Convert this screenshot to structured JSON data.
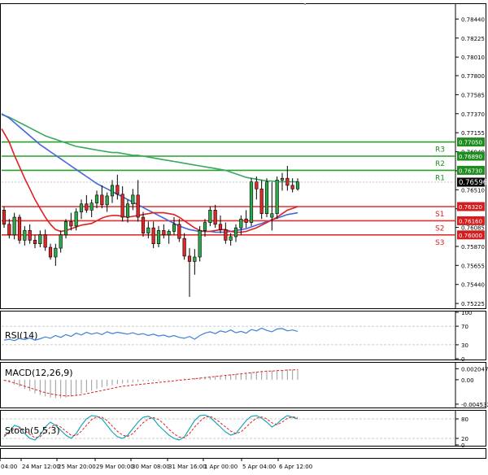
{
  "chart_data": {
    "type": "candlestick",
    "main": {
      "y_ticks": [
        "0.78440",
        "0.78225",
        "0.78010",
        "0.77800",
        "0.77585",
        "0.77370",
        "0.77155",
        "0.76940",
        "0.76725",
        "0.76510",
        "0.76295",
        "0.76085",
        "0.75870",
        "0.75655",
        "0.75440",
        "0.75225"
      ],
      "ylim": [
        0.7518,
        0.786
      ],
      "x_ticks": [
        "04:00",
        "24 Mar 12:00",
        "25 Mar 20:00",
        "29 Mar 00:00",
        "30 Mar 08:00",
        "31 Mar 16:00",
        "1 Apr 00:00",
        "5 Apr 04:00",
        "6 Apr 12:00"
      ],
      "levels": [
        {
          "name": "R3",
          "value": 0.7705,
          "label": "0.77050",
          "color": "#1e8c1e",
          "line": "#2aa02a"
        },
        {
          "name": "R2",
          "value": 0.7689,
          "label": "0.76890",
          "color": "#1e8c1e",
          "line": "#2aa02a"
        },
        {
          "name": "R1",
          "value": 0.7673,
          "label": "0.76730",
          "color": "#1e8c1e",
          "line": "#2aa02a"
        },
        {
          "name": "S1",
          "value": 0.7632,
          "label": "0.76320",
          "color": "#d21e1e",
          "line": "#e03030"
        },
        {
          "name": "S2",
          "value": 0.7616,
          "label": "0.76160",
          "color": "#d21e1e",
          "line": "#e03030"
        },
        {
          "name": "S3",
          "value": 0.76,
          "label": "0.76000",
          "color": "#d21e1e",
          "line": "#e03030"
        }
      ],
      "current_price": "0.76596",
      "current_price_value": 0.76596,
      "candles": [
        [
          0.7628,
          0.7632,
          0.7608,
          0.7612
        ],
        [
          0.7612,
          0.7618,
          0.7596,
          0.76
        ],
        [
          0.76,
          0.7625,
          0.7595,
          0.762
        ],
        [
          0.762,
          0.7623,
          0.759,
          0.7594
        ],
        [
          0.7594,
          0.761,
          0.7588,
          0.7605
        ],
        [
          0.7605,
          0.7612,
          0.759,
          0.7594
        ],
        [
          0.7594,
          0.76,
          0.7585,
          0.759
        ],
        [
          0.759,
          0.7605,
          0.7586,
          0.76
        ],
        [
          0.76,
          0.7606,
          0.7582,
          0.7586
        ],
        [
          0.7586,
          0.759,
          0.7572,
          0.7575
        ],
        [
          0.7575,
          0.759,
          0.7565,
          0.7585
        ],
        [
          0.7585,
          0.7605,
          0.758,
          0.76
        ],
        [
          0.76,
          0.7618,
          0.7596,
          0.7615
        ],
        [
          0.7615,
          0.7625,
          0.7605,
          0.761
        ],
        [
          0.761,
          0.763,
          0.7605,
          0.7626
        ],
        [
          0.7626,
          0.764,
          0.7618,
          0.7635
        ],
        [
          0.7635,
          0.7645,
          0.7625,
          0.7628
        ],
        [
          0.7628,
          0.764,
          0.762,
          0.7636
        ],
        [
          0.7636,
          0.765,
          0.763,
          0.7645
        ],
        [
          0.7645,
          0.7656,
          0.763,
          0.7634
        ],
        [
          0.7634,
          0.7648,
          0.7626,
          0.7644
        ],
        [
          0.7644,
          0.7662,
          0.7636,
          0.7656
        ],
        [
          0.7656,
          0.7668,
          0.764,
          0.7646
        ],
        [
          0.7646,
          0.7655,
          0.7615,
          0.762
        ],
        [
          0.762,
          0.764,
          0.7614,
          0.7635
        ],
        [
          0.7635,
          0.7652,
          0.7628,
          0.7645
        ],
        [
          0.7645,
          0.7662,
          0.7615,
          0.762
        ],
        [
          0.762,
          0.7626,
          0.7598,
          0.7602
        ],
        [
          0.7602,
          0.7615,
          0.7596,
          0.7608
        ],
        [
          0.7608,
          0.7615,
          0.7585,
          0.759
        ],
        [
          0.759,
          0.761,
          0.7586,
          0.7605
        ],
        [
          0.7605,
          0.7612,
          0.7596,
          0.76
        ],
        [
          0.76,
          0.7606,
          0.759,
          0.7604
        ],
        [
          0.7604,
          0.762,
          0.76,
          0.7612
        ],
        [
          0.7612,
          0.7618,
          0.7592,
          0.7596
        ],
        [
          0.7596,
          0.7602,
          0.7572,
          0.7576
        ],
        [
          0.7576,
          0.7585,
          0.753,
          0.757
        ],
        [
          0.757,
          0.7584,
          0.7555,
          0.7575
        ],
        [
          0.7575,
          0.761,
          0.757,
          0.7605
        ],
        [
          0.7605,
          0.7618,
          0.7598,
          0.7614
        ],
        [
          0.7614,
          0.7632,
          0.761,
          0.7628
        ],
        [
          0.7628,
          0.7634,
          0.7608,
          0.7612
        ],
        [
          0.7612,
          0.7622,
          0.7602,
          0.7606
        ],
        [
          0.7606,
          0.7614,
          0.759,
          0.7594
        ],
        [
          0.7594,
          0.7602,
          0.7588,
          0.7598
        ],
        [
          0.7598,
          0.7612,
          0.7592,
          0.7608
        ],
        [
          0.7608,
          0.7622,
          0.76,
          0.7618
        ],
        [
          0.7618,
          0.7628,
          0.7608,
          0.7614
        ],
        [
          0.7614,
          0.7664,
          0.761,
          0.766
        ],
        [
          0.766,
          0.7666,
          0.764,
          0.7652
        ],
        [
          0.7652,
          0.7662,
          0.7618,
          0.7624
        ],
        [
          0.7624,
          0.7664,
          0.762,
          0.766
        ],
        [
          0.762,
          0.766,
          0.7605,
          0.7624
        ],
        [
          0.7624,
          0.7666,
          0.7618,
          0.7662
        ],
        [
          0.7662,
          0.767,
          0.765,
          0.7664
        ],
        [
          0.7664,
          0.7678,
          0.765,
          0.7656
        ],
        [
          0.7656,
          0.7664,
          0.7648,
          0.7652
        ],
        [
          0.7652,
          0.7664,
          0.765,
          0.766
        ]
      ],
      "ma_green": [
        0.7736,
        0.7733,
        0.773,
        0.7727,
        0.7724,
        0.7721,
        0.7718,
        0.7715,
        0.7712,
        0.771,
        0.7708,
        0.7706,
        0.7704,
        0.7702,
        0.77,
        0.7699,
        0.7698,
        0.7697,
        0.7696,
        0.7695,
        0.7694,
        0.7693,
        0.7693,
        0.7692,
        0.7691,
        0.769,
        0.769,
        0.7689,
        0.7688,
        0.7687,
        0.7686,
        0.7685,
        0.7684,
        0.7683,
        0.7682,
        0.7681,
        0.768,
        0.7679,
        0.7678,
        0.7677,
        0.7676,
        0.7675,
        0.7674,
        0.7673,
        0.7671,
        0.7669,
        0.7667,
        0.7665,
        0.7664,
        0.7663,
        0.7662,
        0.7661,
        0.7661,
        0.766,
        0.766,
        0.766,
        0.766,
        0.766
      ],
      "ma_blue": [
        0.7737,
        0.7732,
        0.7727,
        0.7722,
        0.7717,
        0.7712,
        0.7707,
        0.7702,
        0.7698,
        0.7694,
        0.769,
        0.7686,
        0.7682,
        0.7678,
        0.7674,
        0.767,
        0.7666,
        0.7662,
        0.7658,
        0.7655,
        0.7652,
        0.7649,
        0.7646,
        0.7643,
        0.764,
        0.7637,
        0.7634,
        0.7631,
        0.7628,
        0.7625,
        0.7622,
        0.7619,
        0.7616,
        0.7613,
        0.761,
        0.7608,
        0.7606,
        0.7605,
        0.7604,
        0.7604,
        0.7604,
        0.7603,
        0.7603,
        0.7603,
        0.7604,
        0.7605,
        0.7606,
        0.7607,
        0.7609,
        0.7611,
        0.7613,
        0.7615,
        0.7617,
        0.7619,
        0.7621,
        0.7623,
        0.7624,
        0.7625
      ],
      "ma_red": [
        0.772,
        0.7705,
        0.769,
        0.7677,
        0.7664,
        0.7652,
        0.764,
        0.763,
        0.762,
        0.7612,
        0.7606,
        0.7604,
        0.7605,
        0.7607,
        0.7609,
        0.7611,
        0.7612,
        0.7613,
        0.7616,
        0.7619,
        0.7621,
        0.7622,
        0.7622,
        0.7621,
        0.762,
        0.7621,
        0.7622,
        0.7623,
        0.7624,
        0.7625,
        0.7625,
        0.7625,
        0.7624,
        0.7623,
        0.762,
        0.7616,
        0.7612,
        0.7608,
        0.7605,
        0.7604,
        0.7604,
        0.7605,
        0.7606,
        0.7606,
        0.7604,
        0.7603,
        0.7603,
        0.7604,
        0.7606,
        0.7608,
        0.7611,
        0.7614,
        0.7617,
        0.762,
        0.7624,
        0.7628,
        0.763,
        0.7632
      ]
    },
    "rsi": {
      "label": "RSI(14)",
      "ticks": [
        "100",
        "70",
        "30",
        "0"
      ],
      "values": [
        40,
        42,
        39,
        44,
        41,
        45,
        40,
        43,
        47,
        44,
        50,
        46,
        52,
        48,
        55,
        51,
        57,
        53,
        56,
        52,
        58,
        54,
        57,
        55,
        53,
        56,
        52,
        54,
        50,
        53,
        49,
        51,
        47,
        50,
        46,
        44,
        48,
        42,
        50,
        55,
        58,
        54,
        60,
        57,
        62,
        56,
        59,
        55,
        63,
        60,
        66,
        61,
        58,
        64,
        65,
        60,
        62,
        59
      ]
    },
    "macd": {
      "label": "MACD(12,26,9)",
      "ticks": [
        "0.002047",
        "0.00",
        "-0.004532"
      ],
      "histogram": [
        -0.0002,
        -0.0005,
        -0.0009,
        -0.0013,
        -0.0017,
        -0.0021,
        -0.0025,
        -0.0028,
        -0.0031,
        -0.0033,
        -0.0034,
        -0.0034,
        -0.0033,
        -0.0031,
        -0.0029,
        -0.0026,
        -0.0023,
        -0.002,
        -0.0017,
        -0.0014,
        -0.0012,
        -0.001,
        -0.0008,
        -0.0007,
        -0.0006,
        -0.0005,
        -0.0004,
        -0.0003,
        -0.0003,
        -0.0002,
        -0.0002,
        -0.0001,
        -0.0001,
        0.0,
        0.0001,
        0.0002,
        0.0002,
        0.0003,
        0.0004,
        0.0005,
        0.0006,
        0.0007,
        0.0008,
        0.0009,
        0.001,
        0.0011,
        0.0012,
        0.0013,
        0.0014,
        0.0015,
        0.0016,
        0.0017,
        0.0017,
        0.0018,
        0.0018,
        0.0019,
        0.0019,
        0.0019
      ],
      "signal": [
        -0.0001,
        -0.0003,
        -0.0006,
        -0.0009,
        -0.0012,
        -0.0015,
        -0.0018,
        -0.0021,
        -0.0024,
        -0.0026,
        -0.0028,
        -0.0029,
        -0.003,
        -0.003,
        -0.0029,
        -0.0028,
        -0.0026,
        -0.0024,
        -0.0022,
        -0.002,
        -0.0018,
        -0.0016,
        -0.0014,
        -0.0012,
        -0.0011,
        -0.001,
        -0.0009,
        -0.0008,
        -0.0007,
        -0.0006,
        -0.0005,
        -0.0004,
        -0.0003,
        -0.0002,
        -0.0001,
        0.0,
        0.0001,
        0.0002,
        0.0003,
        0.0004,
        0.0005,
        0.0006,
        0.0007,
        0.0008,
        0.0009,
        0.001,
        0.0011,
        0.0012,
        0.0013,
        0.0014,
        0.0015,
        0.0016,
        0.0016,
        0.0017,
        0.0017,
        0.0018,
        0.0018,
        0.0019
      ]
    },
    "stoch": {
      "label": "Stoch(5,5,3)",
      "ticks": [
        "80",
        "20",
        "0"
      ],
      "main_values": [
        25,
        40,
        60,
        55,
        35,
        20,
        15,
        30,
        55,
        70,
        60,
        45,
        30,
        20,
        35,
        60,
        80,
        90,
        88,
        80,
        60,
        40,
        25,
        20,
        30,
        50,
        70,
        85,
        88,
        80,
        60,
        45,
        30,
        20,
        15,
        25,
        50,
        75,
        90,
        92,
        85,
        70,
        55,
        40,
        30,
        35,
        55,
        75,
        88,
        90,
        82,
        70,
        55,
        65,
        80,
        90,
        85,
        80
      ],
      "signal_values": [
        30,
        35,
        48,
        52,
        45,
        32,
        22,
        25,
        40,
        55,
        62,
        55,
        42,
        30,
        28,
        42,
        60,
        78,
        86,
        85,
        75,
        58,
        42,
        30,
        26,
        35,
        52,
        68,
        80,
        84,
        78,
        65,
        48,
        34,
        24,
        22,
        35,
        55,
        72,
        85,
        88,
        80,
        68,
        55,
        42,
        35,
        40,
        55,
        70,
        82,
        86,
        80,
        68,
        62,
        70,
        82,
        86,
        84
      ]
    }
  }
}
